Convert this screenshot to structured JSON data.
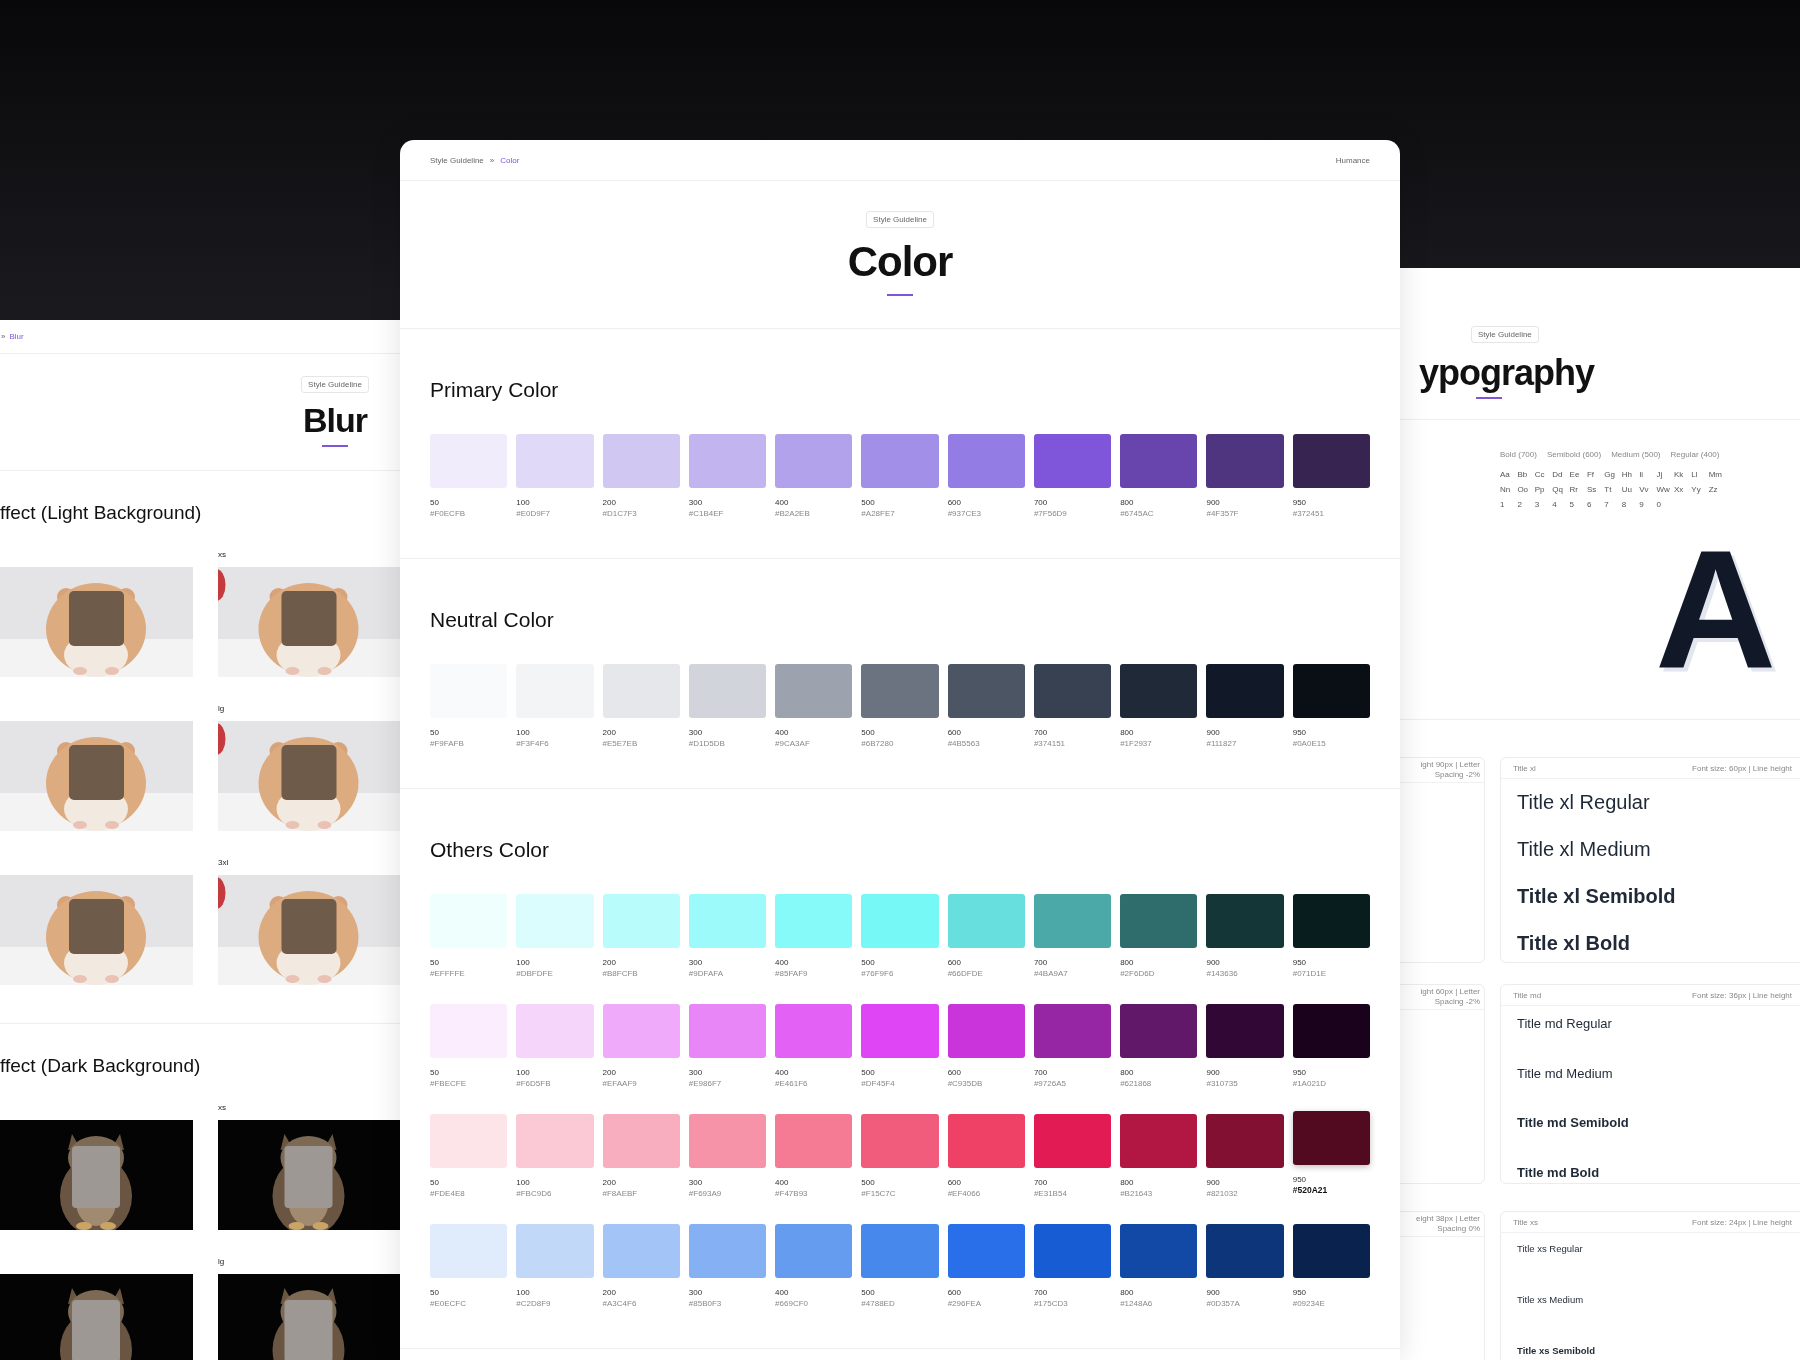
{
  "blur_page": {
    "breadcrumb": [
      {
        "label": "»",
        "current": false
      },
      {
        "label": "Blur",
        "current": true
      }
    ],
    "badge": "Style Guideline",
    "title": "Blur",
    "sections": [
      {
        "heading": "ffect (Light Background)",
        "kind": "light",
        "rows": [
          {
            "label": "xs"
          },
          {
            "label": "lg"
          },
          {
            "label": "3xl"
          }
        ]
      },
      {
        "heading": "ffect (Dark Background)",
        "kind": "dark",
        "rows": [
          {
            "label": "xs"
          },
          {
            "label": "lg"
          }
        ]
      }
    ]
  },
  "color_page": {
    "breadcrumb": [
      {
        "label": "Style Guideline",
        "current": false
      },
      {
        "label": "»",
        "current": false
      },
      {
        "label": "Color",
        "current": true
      }
    ],
    "brand": "Humance",
    "badge": "Style Guideline",
    "title": "Color",
    "palettes": [
      {
        "heading": "Primary Color",
        "rows": [
          {
            "swatches": [
              {
                "shade": "50",
                "hex": "#F0ECFB",
                "color": "#f0ecfb",
                "highlighted": false
              },
              {
                "shade": "100",
                "hex": "#E0D9F7",
                "color": "#e0d9f7",
                "highlighted": false
              },
              {
                "shade": "200",
                "hex": "#D1C7F3",
                "color": "#d1c7f3",
                "highlighted": false
              },
              {
                "shade": "300",
                "hex": "#C1B4EF",
                "color": "#c1b4ef",
                "highlighted": false
              },
              {
                "shade": "400",
                "hex": "#B2A2EB",
                "color": "#b2a2eb",
                "highlighted": false
              },
              {
                "shade": "500",
                "hex": "#A28FE7",
                "color": "#a28fe7",
                "highlighted": false
              },
              {
                "shade": "600",
                "hex": "#937CE3",
                "color": "#937ce3",
                "highlighted": false
              },
              {
                "shade": "700",
                "hex": "#7F56D9",
                "color": "#7f56d9",
                "highlighted": false
              },
              {
                "shade": "800",
                "hex": "#6745AC",
                "color": "#6745ac",
                "highlighted": false
              },
              {
                "shade": "900",
                "hex": "#4F357F",
                "color": "#4f357f",
                "highlighted": false
              },
              {
                "shade": "950",
                "hex": "#372451",
                "color": "#372451",
                "highlighted": false
              }
            ]
          }
        ]
      },
      {
        "heading": "Neutral Color",
        "rows": [
          {
            "swatches": [
              {
                "shade": "50",
                "hex": "#F9FAFB",
                "color": "#f9fafb",
                "highlighted": false
              },
              {
                "shade": "100",
                "hex": "#F3F4F6",
                "color": "#f3f4f6",
                "highlighted": false
              },
              {
                "shade": "200",
                "hex": "#E5E7EB",
                "color": "#e5e7eb",
                "highlighted": false
              },
              {
                "shade": "300",
                "hex": "#D1D5DB",
                "color": "#d1d5db",
                "highlighted": false
              },
              {
                "shade": "400",
                "hex": "#9CA3AF",
                "color": "#9ca3af",
                "highlighted": false
              },
              {
                "shade": "500",
                "hex": "#6B7280",
                "color": "#6b7280",
                "highlighted": false
              },
              {
                "shade": "600",
                "hex": "#4B5563",
                "color": "#4b5563",
                "highlighted": false
              },
              {
                "shade": "700",
                "hex": "#374151",
                "color": "#374151",
                "highlighted": false
              },
              {
                "shade": "800",
                "hex": "#1F2937",
                "color": "#1f2937",
                "highlighted": false
              },
              {
                "shade": "900",
                "hex": "#111827",
                "color": "#111827",
                "highlighted": false
              },
              {
                "shade": "950",
                "hex": "#0A0E15",
                "color": "#0a0e15",
                "highlighted": false
              }
            ]
          }
        ]
      },
      {
        "heading": "Others Color",
        "rows": [
          {
            "swatches": [
              {
                "shade": "50",
                "hex": "#EFFFFE",
                "color": "#effffe",
                "highlighted": false
              },
              {
                "shade": "100",
                "hex": "#DBFDFE",
                "color": "#dbfdfe",
                "highlighted": false
              },
              {
                "shade": "200",
                "hex": "#B8FCFB",
                "color": "#b8fcfb",
                "highlighted": false
              },
              {
                "shade": "300",
                "hex": "#9DFAFA",
                "color": "#9dfafa",
                "highlighted": false
              },
              {
                "shade": "400",
                "hex": "#85FAF9",
                "color": "#85faf9",
                "highlighted": false
              },
              {
                "shade": "500",
                "hex": "#76F9F6",
                "color": "#76f9f6",
                "highlighted": false
              },
              {
                "shade": "600",
                "hex": "#66DFDE",
                "color": "#66dfde",
                "highlighted": false
              },
              {
                "shade": "700",
                "hex": "#4BA9A7",
                "color": "#4ba9a7",
                "highlighted": false
              },
              {
                "shade": "800",
                "hex": "#2F6D6D",
                "color": "#2f6d6d",
                "highlighted": false
              },
              {
                "shade": "900",
                "hex": "#143636",
                "color": "#143636",
                "highlighted": false
              },
              {
                "shade": "950",
                "hex": "#071D1E",
                "color": "#071d1e",
                "highlighted": false
              }
            ]
          },
          {
            "swatches": [
              {
                "shade": "50",
                "hex": "#FBECFE",
                "color": "#fbecfe",
                "highlighted": false
              },
              {
                "shade": "100",
                "hex": "#F6D5FB",
                "color": "#f6d5fb",
                "highlighted": false
              },
              {
                "shade": "200",
                "hex": "#EFAAF9",
                "color": "#efaaf9",
                "highlighted": false
              },
              {
                "shade": "300",
                "hex": "#E986F7",
                "color": "#e986f7",
                "highlighted": false
              },
              {
                "shade": "400",
                "hex": "#E461F6",
                "color": "#e461f6",
                "highlighted": false
              },
              {
                "shade": "500",
                "hex": "#DF45F4",
                "color": "#df45f4",
                "highlighted": false
              },
              {
                "shade": "600",
                "hex": "#C935DB",
                "color": "#c935db",
                "highlighted": false
              },
              {
                "shade": "700",
                "hex": "#9726A5",
                "color": "#9726a5",
                "highlighted": false
              },
              {
                "shade": "800",
                "hex": "#621868",
                "color": "#621868",
                "highlighted": false
              },
              {
                "shade": "900",
                "hex": "#310735",
                "color": "#310735",
                "highlighted": false
              },
              {
                "shade": "950",
                "hex": "#1A021D",
                "color": "#1a021d",
                "highlighted": false
              }
            ]
          },
          {
            "swatches": [
              {
                "shade": "50",
                "hex": "#FDE4E8",
                "color": "#fde4e8",
                "highlighted": false
              },
              {
                "shade": "100",
                "hex": "#FBC9D6",
                "color": "#fbc9d6",
                "highlighted": false
              },
              {
                "shade": "200",
                "hex": "#F8AEBF",
                "color": "#f8aebf",
                "highlighted": false
              },
              {
                "shade": "300",
                "hex": "#F693A9",
                "color": "#f693a9",
                "highlighted": false
              },
              {
                "shade": "400",
                "hex": "#F47B93",
                "color": "#f47b93",
                "highlighted": false
              },
              {
                "shade": "500",
                "hex": "#F15C7C",
                "color": "#f15c7c",
                "highlighted": false
              },
              {
                "shade": "600",
                "hex": "#EF4066",
                "color": "#ef4066",
                "highlighted": false
              },
              {
                "shade": "700",
                "hex": "#E31B54",
                "color": "#e31b54",
                "highlighted": false
              },
              {
                "shade": "800",
                "hex": "#B21643",
                "color": "#b21643",
                "highlighted": false
              },
              {
                "shade": "900",
                "hex": "#821032",
                "color": "#821032",
                "highlighted": false
              },
              {
                "shade": "950",
                "hex": "#520A21",
                "color": "#520a21",
                "highlighted": true
              }
            ]
          },
          {
            "swatches": [
              {
                "shade": "50",
                "hex": "#E0ECFC",
                "color": "#e0ecfc",
                "highlighted": false
              },
              {
                "shade": "100",
                "hex": "#C2D8F9",
                "color": "#c2d8f9",
                "highlighted": false
              },
              {
                "shade": "200",
                "hex": "#A3C4F6",
                "color": "#a3c4f6",
                "highlighted": false
              },
              {
                "shade": "300",
                "hex": "#85B0F3",
                "color": "#85b0f3",
                "highlighted": false
              },
              {
                "shade": "400",
                "hex": "#669CF0",
                "color": "#669cf0",
                "highlighted": false
              },
              {
                "shade": "500",
                "hex": "#4788ED",
                "color": "#4788ed",
                "highlighted": false
              },
              {
                "shade": "600",
                "hex": "#296FEA",
                "color": "#296fea",
                "highlighted": false
              },
              {
                "shade": "700",
                "hex": "#175CD3",
                "color": "#175cd3",
                "highlighted": false
              },
              {
                "shade": "800",
                "hex": "#1248A6",
                "color": "#1248a6",
                "highlighted": false
              },
              {
                "shade": "900",
                "hex": "#0D357A",
                "color": "#0d357a",
                "highlighted": false
              },
              {
                "shade": "950",
                "hex": "#09234E",
                "color": "#09234e",
                "highlighted": false
              }
            ]
          }
        ]
      }
    ]
  },
  "typography_page": {
    "badge": "Style Guideline",
    "title": "ypography",
    "weights": [
      "Bold (700)",
      "Semibold (600)",
      "Medium (500)",
      "Regular (400)"
    ],
    "glyph_rows": [
      [
        "Aa",
        "Bb",
        "Cc",
        "Dd",
        "Ee",
        "Ff",
        "Gg",
        "Hh",
        "Ii",
        "Jj",
        "Kk",
        "Ll",
        "Mm"
      ],
      [
        "Nn",
        "Oo",
        "Pp",
        "Qq",
        "Rr",
        "Ss",
        "Tt",
        "Uu",
        "Vv",
        "Ww",
        "Xx",
        "Yy",
        "Zz"
      ],
      [
        "1",
        "2",
        "3",
        "4",
        "5",
        "6",
        "7",
        "8",
        "9",
        "0"
      ]
    ],
    "specimen": "A",
    "style_groups": [
      {
        "kind": "xl",
        "spec_note": "ight 90px | Letter Spacing -2%",
        "name": "Title xl",
        "size_note": "Font size: 60px | Line height",
        "samples": [
          {
            "text": "Title xl Regular",
            "kind": "regular"
          },
          {
            "text": "Title xl Medium",
            "kind": "medium"
          },
          {
            "text": "Title xl Semibold",
            "kind": "semibold"
          },
          {
            "text": "Title xl Bold",
            "kind": "bold"
          }
        ]
      },
      {
        "kind": "md",
        "spec_note": "ight 60px | Letter Spacing -2%",
        "name": "Title md",
        "size_note": "Font size: 36px | Line height",
        "samples": [
          {
            "text": "Title md Regular",
            "kind": "regular"
          },
          {
            "text": "Title md Medium",
            "kind": "medium"
          },
          {
            "text": "Title md Semibold",
            "kind": "semibold"
          },
          {
            "text": "Title md Bold",
            "kind": "bold"
          }
        ]
      },
      {
        "kind": "xs",
        "spec_note": "eight 38px | Letter Spacing 0%",
        "name": "Title xs",
        "size_note": "Font size: 24px | Line height",
        "samples": [
          {
            "text": "Title xs Regular",
            "kind": "regular"
          },
          {
            "text": "Title xs Medium",
            "kind": "medium"
          },
          {
            "text": "Title xs Semibold",
            "kind": "semibold"
          }
        ]
      }
    ]
  }
}
